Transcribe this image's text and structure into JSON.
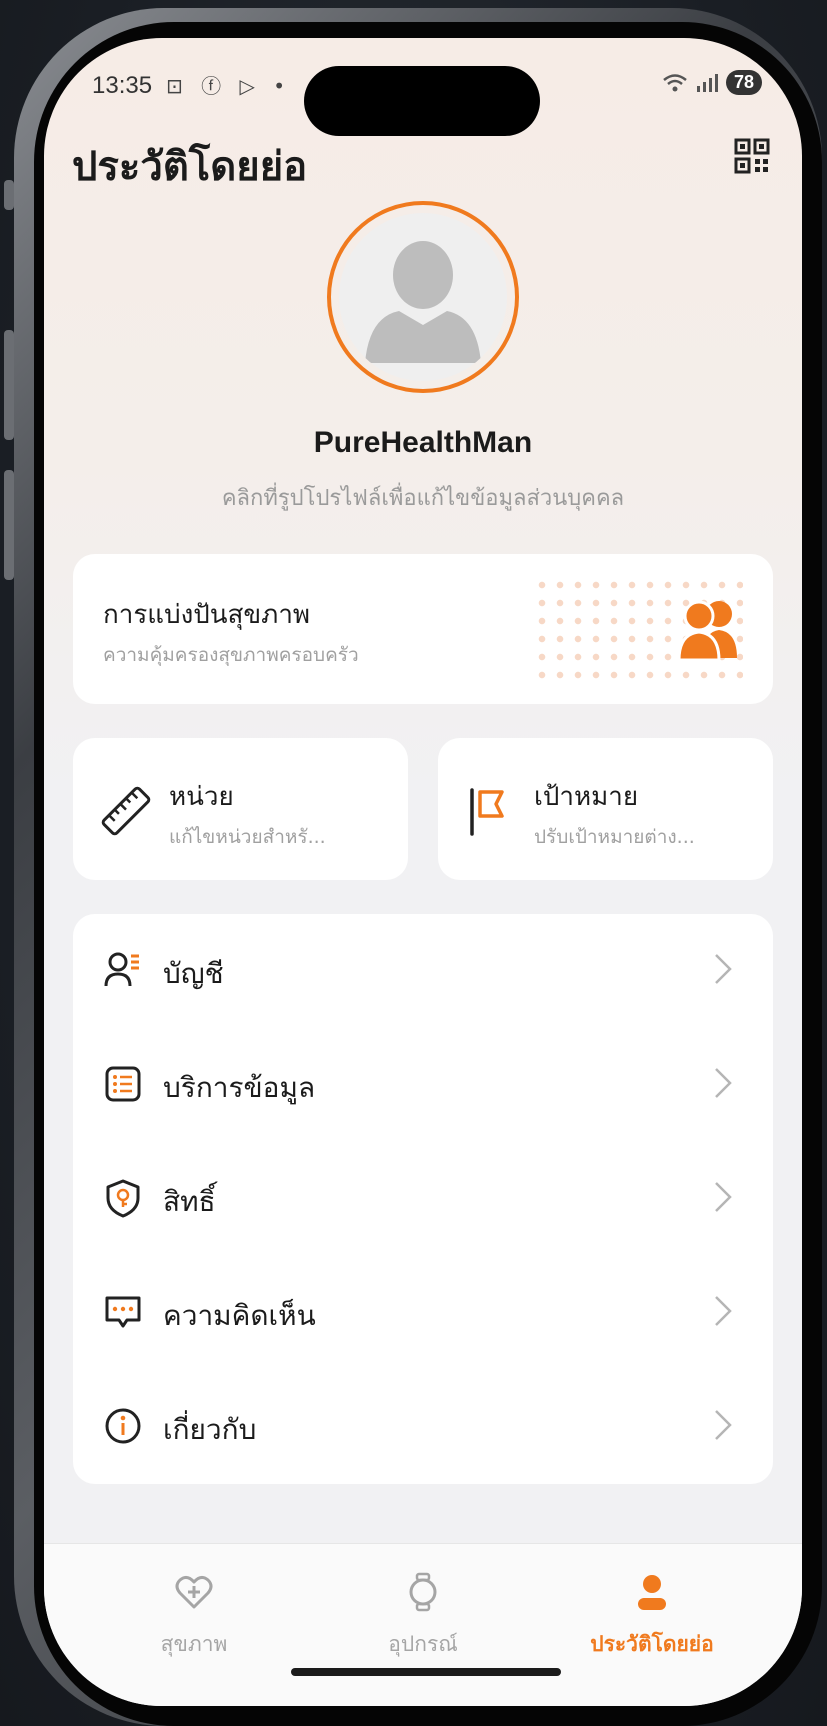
{
  "status_bar": {
    "time": "13:35",
    "left_icons": "⊡ ⓕ ▷ •",
    "battery": "78"
  },
  "header": {
    "title": "ประวัติโดยย่อ"
  },
  "profile": {
    "username": "PureHealthMan",
    "hint": "คลิกที่รูปโปรไฟล์เพื่อแก้ไขข้อมูลส่วนบุคคล"
  },
  "health_share": {
    "title": "การแบ่งปันสุขภาพ",
    "subtitle": "ความคุ้มครองสุขภาพครอบครัว"
  },
  "quick_cards": {
    "unit": {
      "title": "หน่วย",
      "subtitle": "แก้ไขหน่วยสำหรั..."
    },
    "goal": {
      "title": "เป้าหมาย",
      "subtitle": "ปรับเป้าหมายต่าง..."
    }
  },
  "menu": {
    "items": [
      {
        "label": "บัญชี",
        "icon": "account-icon"
      },
      {
        "label": "บริการข้อมูล",
        "icon": "data-service-icon"
      },
      {
        "label": "สิทธิ์",
        "icon": "permission-shield-icon"
      },
      {
        "label": "ความคิดเห็น",
        "icon": "feedback-icon"
      },
      {
        "label": "เกี่ยวกับ",
        "icon": "info-icon"
      }
    ]
  },
  "tabbar": {
    "tabs": [
      {
        "label": "สุขภาพ",
        "icon": "heart-plus-icon"
      },
      {
        "label": "อุปกรณ์",
        "icon": "watch-icon"
      },
      {
        "label": "ประวัติโดยย่อ",
        "icon": "person-icon"
      }
    ],
    "active_index": 2
  },
  "colors": {
    "accent": "#f07a1e",
    "text": "#1b1b1b",
    "muted": "#a0a0a0"
  }
}
